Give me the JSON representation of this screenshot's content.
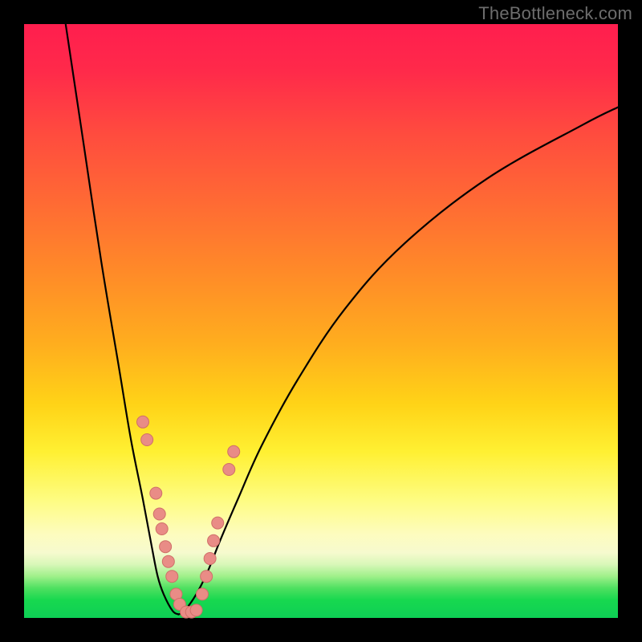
{
  "watermark": "TheBottleneck.com",
  "colors": {
    "frame": "#000000",
    "curve": "#000000",
    "dot_fill": "#e98c86",
    "dot_stroke": "#cf6f68"
  },
  "chart_data": {
    "type": "line",
    "title": "",
    "xlabel": "",
    "ylabel": "",
    "xlim": [
      0,
      100
    ],
    "ylim": [
      0,
      100
    ],
    "grid": false,
    "legend": false,
    "series": [
      {
        "name": "left-branch",
        "x": [
          7,
          10,
          13,
          16,
          18,
          20,
          21.5,
          22.5,
          23.5,
          25,
          26
        ],
        "y": [
          100,
          80,
          60,
          42,
          30,
          20,
          12,
          7,
          4,
          1.2,
          0.6
        ]
      },
      {
        "name": "right-branch",
        "x": [
          26,
          27,
          29,
          31,
          33,
          36,
          40,
          46,
          54,
          64,
          78,
          94,
          100
        ],
        "y": [
          0.6,
          1.2,
          4,
          8,
          13,
          20,
          29,
          40,
          52,
          63,
          74,
          83,
          86
        ]
      }
    ],
    "scatter": {
      "name": "highlighted-points",
      "points": [
        {
          "x": 20.0,
          "y": 33
        },
        {
          "x": 20.7,
          "y": 30
        },
        {
          "x": 22.2,
          "y": 21
        },
        {
          "x": 22.8,
          "y": 17.5
        },
        {
          "x": 23.2,
          "y": 15
        },
        {
          "x": 23.8,
          "y": 12
        },
        {
          "x": 24.3,
          "y": 9.5
        },
        {
          "x": 24.9,
          "y": 7
        },
        {
          "x": 25.6,
          "y": 4
        },
        {
          "x": 26.2,
          "y": 2.3
        },
        {
          "x": 27.3,
          "y": 1.0
        },
        {
          "x": 28.2,
          "y": 1.0
        },
        {
          "x": 29.0,
          "y": 1.3
        },
        {
          "x": 30.0,
          "y": 4
        },
        {
          "x": 30.7,
          "y": 7
        },
        {
          "x": 31.3,
          "y": 10
        },
        {
          "x": 31.9,
          "y": 13
        },
        {
          "x": 32.6,
          "y": 16
        },
        {
          "x": 34.5,
          "y": 25
        },
        {
          "x": 35.3,
          "y": 28
        }
      ]
    },
    "gradient_bands": [
      {
        "y_pct": 0,
        "color": "#ff1e4e"
      },
      {
        "y_pct": 50,
        "color": "#ffae1e"
      },
      {
        "y_pct": 78,
        "color": "#fefc80"
      },
      {
        "y_pct": 95,
        "color": "#17d84f"
      }
    ]
  }
}
